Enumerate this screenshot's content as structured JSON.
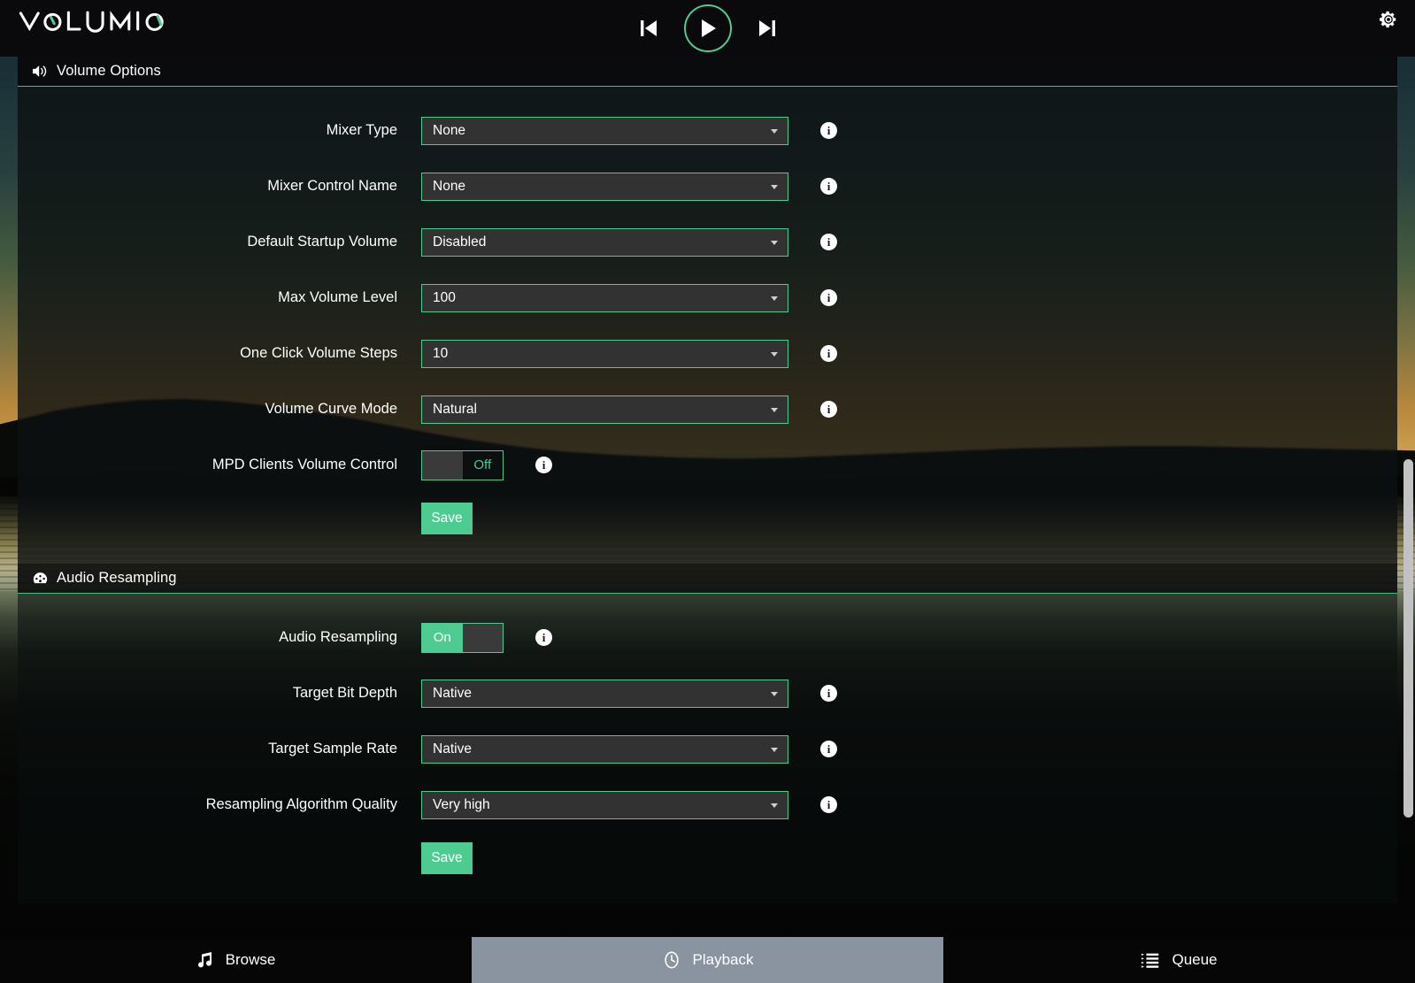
{
  "app": {
    "brand": "VOLUMIO",
    "accent_color": "#4ecb91",
    "panel_bg": "#0c1011",
    "select_bg": "#323232"
  },
  "header": {
    "previous_label": "Previous",
    "play_label": "Play",
    "next_label": "Next",
    "settings_label": "Settings",
    "icons": {
      "previous": "step-backward-icon",
      "play": "play-icon",
      "next": "step-forward-icon",
      "settings": "gear-icon"
    }
  },
  "sections": [
    {
      "id": "volume-options",
      "title": "Volume Options",
      "icon": "speaker-volume-icon",
      "save_label": "Save",
      "rows": [
        {
          "label": "Mixer Type",
          "type": "select",
          "value": "None"
        },
        {
          "label": "Mixer Control Name",
          "type": "select",
          "value": "None"
        },
        {
          "label": "Default Startup Volume",
          "type": "select",
          "value": "Disabled"
        },
        {
          "label": "Max Volume Level",
          "type": "select",
          "value": "100"
        },
        {
          "label": "One Click Volume Steps",
          "type": "select",
          "value": "10"
        },
        {
          "label": "Volume Curve Mode",
          "type": "select",
          "value": "Natural"
        },
        {
          "label": "MPD Clients Volume Control",
          "type": "toggle",
          "value": "Off",
          "state": "off"
        }
      ]
    },
    {
      "id": "audio-resampling",
      "title": "Audio Resampling",
      "icon": "gauge-icon",
      "save_label": "Save",
      "rows": [
        {
          "label": "Audio Resampling",
          "type": "toggle",
          "value": "On",
          "state": "on"
        },
        {
          "label": "Target Bit Depth",
          "type": "select",
          "value": "Native"
        },
        {
          "label": "Target Sample Rate",
          "type": "select",
          "value": "Native"
        },
        {
          "label": "Resampling Algorithm Quality",
          "type": "select",
          "value": "Very high"
        }
      ]
    }
  ],
  "info_tooltip_label": "i",
  "bottom_nav": {
    "items": [
      {
        "label": "Browse",
        "icon": "music-note-icon",
        "active": false
      },
      {
        "label": "Playback",
        "icon": "playback-circle-icon",
        "active": true
      },
      {
        "label": "Queue",
        "icon": "list-icon",
        "active": false
      }
    ]
  }
}
